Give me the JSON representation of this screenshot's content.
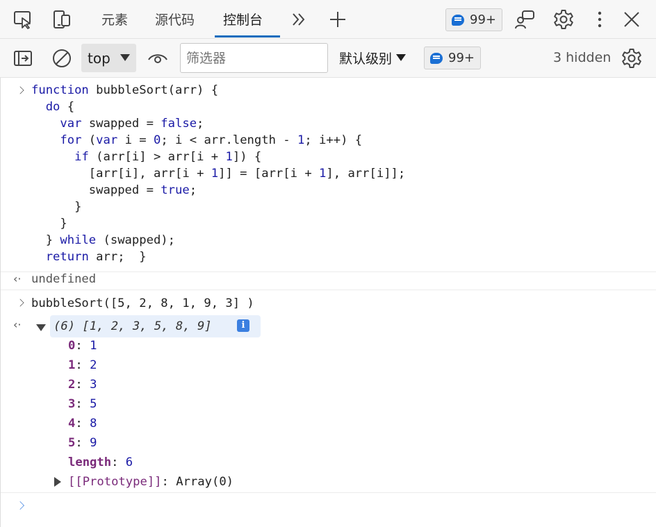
{
  "tabs": [
    {
      "label": "元素"
    },
    {
      "label": "源代码"
    },
    {
      "label": "控制台"
    }
  ],
  "tab_active": "控制台",
  "issues_badge": "99+",
  "toolbar": {
    "context": "top",
    "filter_placeholder": "筛选器",
    "levels_label": "默认级别",
    "messages_badge": "99+",
    "hidden_label": "3 hidden"
  },
  "console": {
    "code_lines": [
      [
        {
          "t": "function bubbleSort(arr) {",
          "c": "kw-fn"
        }
      ],
      [
        {
          "t": "  do {",
          "c": ""
        }
      ],
      [
        {
          "t": "    var swapped = false;",
          "c": ""
        }
      ],
      [
        {
          "t": "    for (var i = 0; i < arr.length - 1; i++) {",
          "c": ""
        }
      ],
      [
        {
          "t": "      if (arr[i] > arr[i + 1]) {",
          "c": ""
        }
      ],
      [
        {
          "t": "        [arr[i], arr[i + 1]] = [arr[i + 1], arr[i]];",
          "c": ""
        }
      ],
      [
        {
          "t": "        swapped = true;",
          "c": ""
        }
      ],
      [
        {
          "t": "      }",
          "c": ""
        }
      ],
      [
        {
          "t": "    }",
          "c": ""
        }
      ],
      [
        {
          "t": "  } while (swapped);",
          "c": ""
        }
      ],
      [
        {
          "t": "  return arr;  }",
          "c": ""
        }
      ]
    ],
    "result_1": "undefined",
    "call_line": "bubbleSort([5, 2, 8, 1, 9, 3] )",
    "array_preview": "(6) [1, 2, 3, 5, 8, 9]",
    "array_props": [
      {
        "key": "0",
        "value": "1"
      },
      {
        "key": "1",
        "value": "2"
      },
      {
        "key": "2",
        "value": "3"
      },
      {
        "key": "3",
        "value": "5"
      },
      {
        "key": "4",
        "value": "8"
      },
      {
        "key": "5",
        "value": "9"
      },
      {
        "key": "length",
        "value": "6"
      }
    ],
    "prototype_key": "[[Prototype]]",
    "prototype_value": "Array(0)"
  },
  "colors": {
    "accent": "#0f6cbd",
    "keyword": "#1a1aa6",
    "property_key": "#7a2a7a",
    "badge_blue": "#1a6fd4"
  },
  "icons": [
    "inspect-element-icon",
    "device-emulation-icon",
    "more-tabs-icon",
    "add-tab-icon",
    "feedback-icon",
    "settings-icon",
    "more-options-icon",
    "close-icon",
    "show-sidebar-icon",
    "clear-console-icon",
    "live-expression-icon",
    "console-settings-icon",
    "info-icon"
  ]
}
